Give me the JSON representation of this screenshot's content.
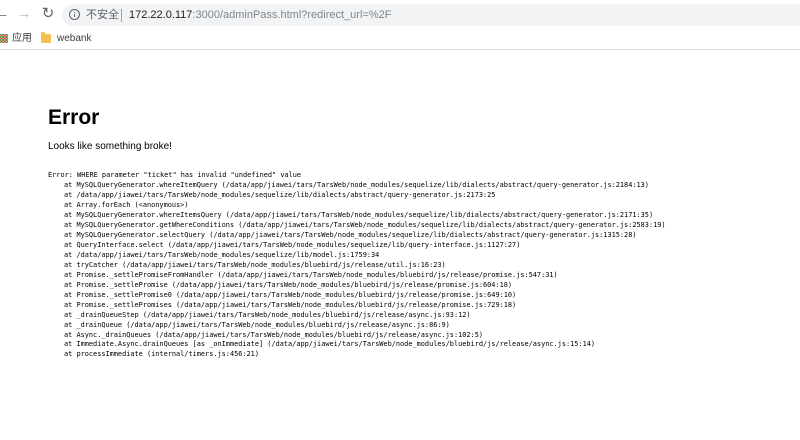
{
  "toolbar": {
    "security_label": "不安全",
    "url_host": "172.22.0.117",
    "url_rest": ":3000/adminPass.html?redirect_url=%2F"
  },
  "bookmarks": [
    {
      "label": "应用",
      "icon": "apps-grid-icon"
    },
    {
      "label": "webank",
      "icon": "folder-icon"
    }
  ],
  "page": {
    "title": "Error",
    "message": "Looks like something broke!",
    "stack_header": "Error: WHERE parameter \"ticket\" has invalid \"undefined\" value",
    "stack_frames": [
      "at MySQLQueryGenerator.whereItemQuery (/data/app/jiawei/tars/TarsWeb/node_modules/sequelize/lib/dialects/abstract/query-generator.js:2184:13)",
      "at /data/app/jiawei/tars/TarsWeb/node_modules/sequelize/lib/dialects/abstract/query-generator.js:2173:25",
      "at Array.forEach (<anonymous>)",
      "at MySQLQueryGenerator.whereItemsQuery (/data/app/jiawei/tars/TarsWeb/node_modules/sequelize/lib/dialects/abstract/query-generator.js:2171:35)",
      "at MySQLQueryGenerator.getWhereConditions (/data/app/jiawei/tars/TarsWeb/node_modules/sequelize/lib/dialects/abstract/query-generator.js:2583:19)",
      "at MySQLQueryGenerator.selectQuery (/data/app/jiawei/tars/TarsWeb/node_modules/sequelize/lib/dialects/abstract/query-generator.js:1315:28)",
      "at QueryInterface.select (/data/app/jiawei/tars/TarsWeb/node_modules/sequelize/lib/query-interface.js:1127:27)",
      "at /data/app/jiawei/tars/TarsWeb/node_modules/sequelize/lib/model.js:1759:34",
      "at tryCatcher (/data/app/jiawei/tars/TarsWeb/node_modules/bluebird/js/release/util.js:16:23)",
      "at Promise._settlePromiseFromHandler (/data/app/jiawei/tars/TarsWeb/node_modules/bluebird/js/release/promise.js:547:31)",
      "at Promise._settlePromise (/data/app/jiawei/tars/TarsWeb/node_modules/bluebird/js/release/promise.js:604:18)",
      "at Promise._settlePromise0 (/data/app/jiawei/tars/TarsWeb/node_modules/bluebird/js/release/promise.js:649:10)",
      "at Promise._settlePromises (/data/app/jiawei/tars/TarsWeb/node_modules/bluebird/js/release/promise.js:729:18)",
      "at _drainQueueStep (/data/app/jiawei/tars/TarsWeb/node_modules/bluebird/js/release/async.js:93:12)",
      "at _drainQueue (/data/app/jiawei/tars/TarsWeb/node_modules/bluebird/js/release/async.js:86:9)",
      "at Async._drainQueues (/data/app/jiawei/tars/TarsWeb/node_modules/bluebird/js/release/async.js:102:5)",
      "at Immediate.Async.drainQueues [as _onImmediate] (/data/app/jiawei/tars/TarsWeb/node_modules/bluebird/js/release/async.js:15:14)",
      "at processImmediate (internal/timers.js:456:21)"
    ]
  }
}
